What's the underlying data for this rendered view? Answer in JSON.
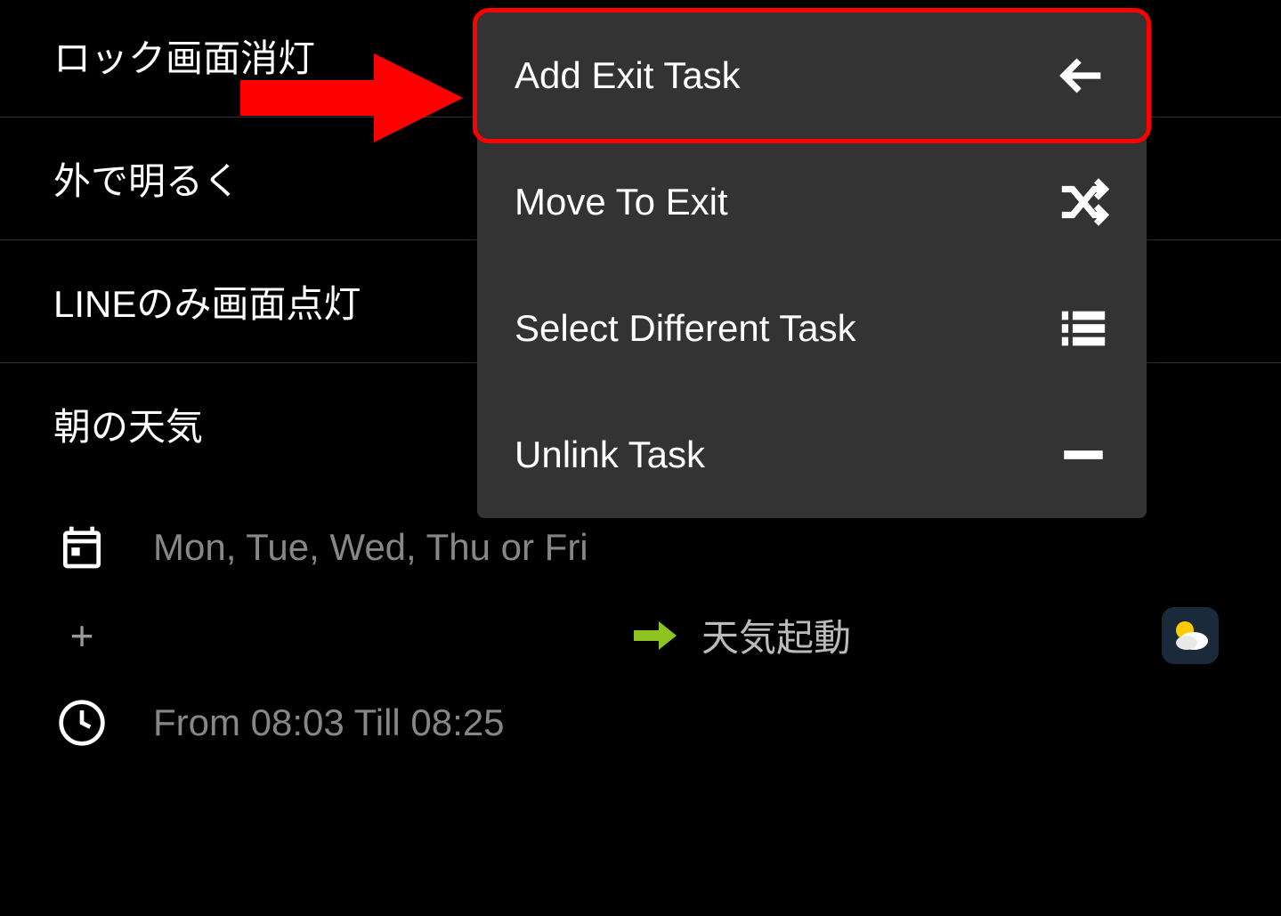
{
  "profiles": [
    {
      "label": "ロック画面消灯"
    },
    {
      "label": "外で明るく"
    },
    {
      "label": "LINEのみ画面点灯"
    },
    {
      "label": "朝の天気"
    }
  ],
  "details": {
    "schedule_days": "Mon, Tue, Wed, Thu or Fri",
    "time_range": "From 08:03 Till 08:25",
    "task_name": "天気起動",
    "plus_label": "+"
  },
  "context_menu": {
    "items": [
      {
        "label": "Add Exit Task",
        "icon": "arrow-left"
      },
      {
        "label": "Move To Exit",
        "icon": "shuffle"
      },
      {
        "label": "Select Different Task",
        "icon": "list"
      },
      {
        "label": "Unlink Task",
        "icon": "minus"
      }
    ]
  }
}
